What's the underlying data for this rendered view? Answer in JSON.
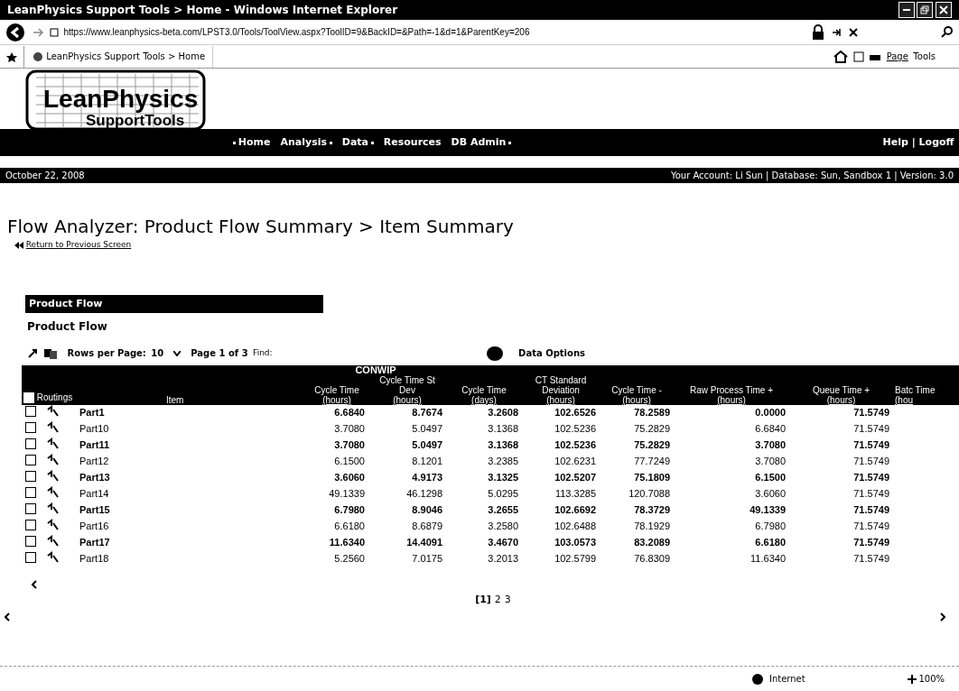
{
  "window": {
    "title": "LeanPhysics Support Tools > Home - Windows Internet Explorer"
  },
  "address_bar": {
    "url": "https://www.leanphysics-beta.com/LPST3.0/Tools/ToolView.aspx?ToolID=9&BackID=&Path=-1&d=1&ParentKey=206"
  },
  "tab": {
    "label": "LeanPhysics Support Tools > Home"
  },
  "command_bar": {
    "page": "Page",
    "tools": "Tools"
  },
  "logo": {
    "line1": "LeanPhysics",
    "line2": "SupportTools"
  },
  "nav": {
    "items": [
      {
        "label": "Home",
        "dropdown": false
      },
      {
        "label": "Analysis",
        "dropdown": true
      },
      {
        "label": "Data",
        "dropdown": true
      },
      {
        "label": "Resources",
        "dropdown": false
      },
      {
        "label": "DB Admin",
        "dropdown": true
      }
    ],
    "right": "Help | Logoff"
  },
  "info_bar": {
    "date": "October 22, 2008",
    "account": "Your Account: Li Sun  |  Database: Sun, Sandbox 1  |  Version: 3.0"
  },
  "heading": "Flow Analyzer: Product Flow Summary > Item Summary",
  "back_link": "Return to Previous Screen",
  "section": {
    "title": "Product Flow",
    "subtitle": "Product Flow"
  },
  "toolbar": {
    "rows_label": "Rows per Page:",
    "rows_value": "10",
    "page_info": "Page 1 of 3",
    "find_label": "Find:",
    "data_options": "Data Options"
  },
  "table": {
    "group_header": "CONWIP",
    "select_all": {
      "checked": false
    },
    "routings_header": "Routings",
    "columns": [
      "Item",
      "Cycle Time (hours)",
      "Cycle Time St Dev (hours)",
      "Cycle Time (days)",
      "CT Standard Deviation (hours)",
      "Cycle Time - (hours)",
      "Raw Process Time + (hours)",
      "Queue Time + (hours)",
      "Batc Time (hou"
    ],
    "rows": [
      {
        "checked": false,
        "bold": true,
        "cells": [
          "Part1",
          "6.6840",
          "8.7674",
          "3.2608",
          "102.6526",
          "78.2589",
          "0.0000",
          "71.5749"
        ]
      },
      {
        "checked": false,
        "bold": false,
        "cells": [
          "Part10",
          "3.7080",
          "5.0497",
          "3.1368",
          "102.5236",
          "75.2829",
          "6.6840",
          "71.5749"
        ]
      },
      {
        "checked": false,
        "bold": true,
        "cells": [
          "Part11",
          "3.7080",
          "5.0497",
          "3.1368",
          "102.5236",
          "75.2829",
          "3.7080",
          "71.5749"
        ]
      },
      {
        "checked": false,
        "bold": false,
        "cells": [
          "Part12",
          "6.1500",
          "8.1201",
          "3.2385",
          "102.6231",
          "77.7249",
          "3.7080",
          "71.5749"
        ]
      },
      {
        "checked": false,
        "bold": true,
        "cells": [
          "Part13",
          "3.6060",
          "4.9173",
          "3.1325",
          "102.5207",
          "75.1809",
          "6.1500",
          "71.5749"
        ]
      },
      {
        "checked": false,
        "bold": false,
        "cells": [
          "Part14",
          "49.1339",
          "46.1298",
          "5.0295",
          "113.3285",
          "120.7088",
          "3.6060",
          "71.5749"
        ]
      },
      {
        "checked": false,
        "bold": true,
        "cells": [
          "Part15",
          "6.7980",
          "8.9046",
          "3.2655",
          "102.6692",
          "78.3729",
          "49.1339",
          "71.5749"
        ]
      },
      {
        "checked": false,
        "bold": false,
        "cells": [
          "Part16",
          "6.6180",
          "8.6879",
          "3.2580",
          "102.6488",
          "78.1929",
          "6.7980",
          "71.5749"
        ]
      },
      {
        "checked": false,
        "bold": true,
        "cells": [
          "Part17",
          "11.6340",
          "14.4091",
          "3.4670",
          "103.0573",
          "83.2089",
          "6.6180",
          "71.5749"
        ]
      },
      {
        "checked": false,
        "bold": false,
        "cells": [
          "Part18",
          "5.2560",
          "7.0175",
          "3.2013",
          "102.5799",
          "76.8309",
          "11.6340",
          "71.5749"
        ]
      }
    ]
  },
  "pager": [
    {
      "label": "[1]",
      "selected": true
    },
    {
      "label": "2",
      "selected": false
    },
    {
      "label": "3",
      "selected": false
    }
  ],
  "status_bar": {
    "zone": "Internet",
    "zoom": "100%"
  }
}
